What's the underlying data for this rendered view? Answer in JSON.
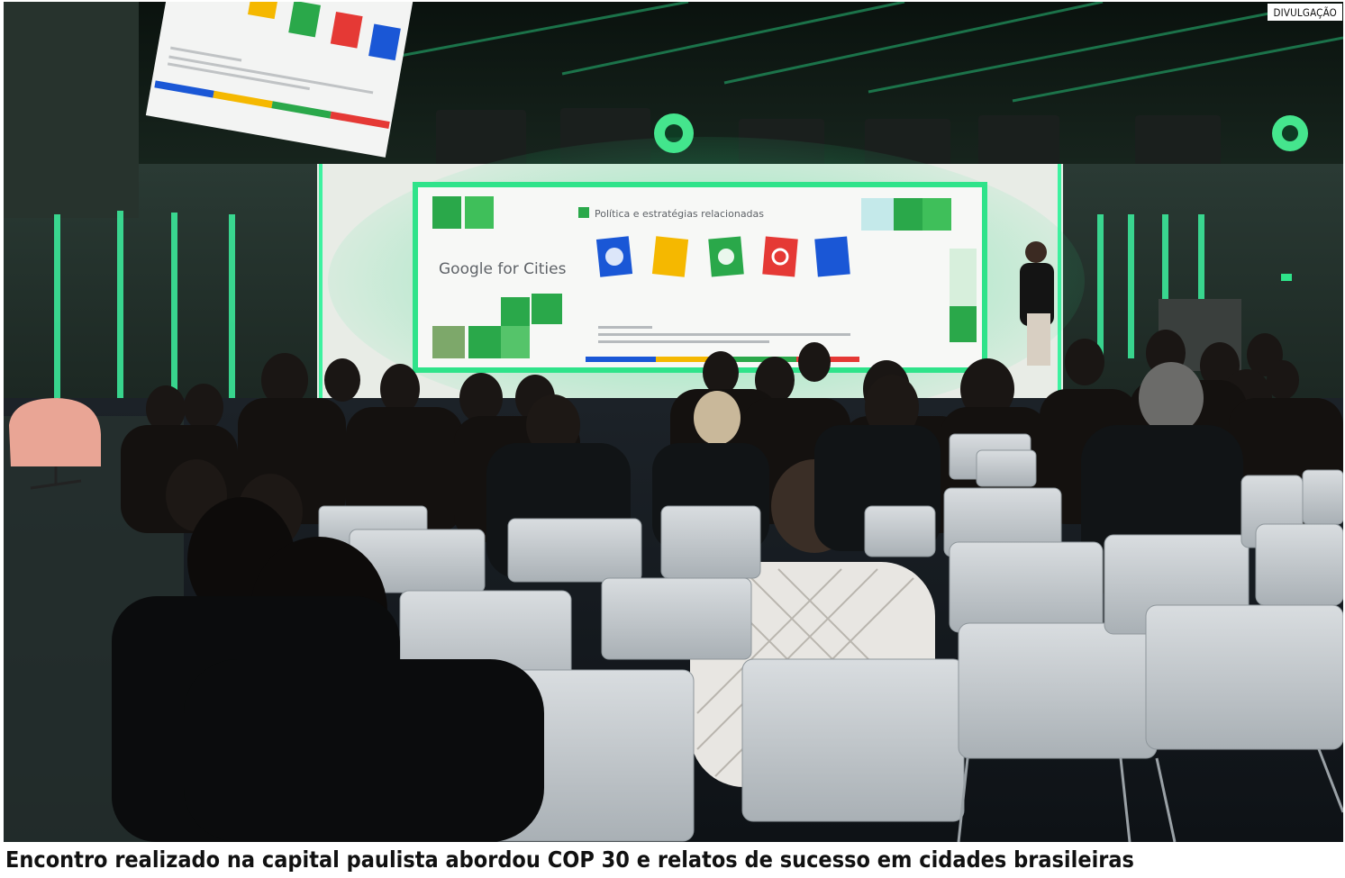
{
  "photo": {
    "credit": "DIVULGAÇÃO",
    "caption": "Encontro realizado na capital paulista abordou COP 30 e relatos de sucesso em cidades brasileiras",
    "screen": {
      "brand": "Google for Cities",
      "heading": "Política e estratégias relacionadas"
    }
  },
  "colors": {
    "accent_green": "#2fe38a",
    "google_blue": "#1a57d6",
    "google_yellow": "#f5b800",
    "google_green": "#2aa84a",
    "google_red": "#e53935"
  }
}
